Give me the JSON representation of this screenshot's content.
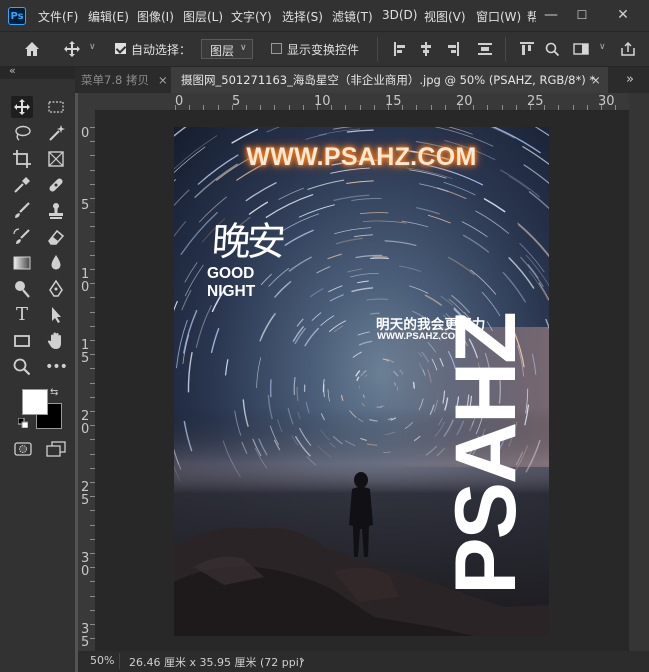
{
  "app": {
    "logo_text": "Ps",
    "menus": [
      "文件(F)",
      "编辑(E)",
      "图像(I)",
      "图层(L)",
      "文字(Y)",
      "选择(S)",
      "滤镜(T)",
      "3D(D)",
      "视图(V)",
      "窗口(W)",
      "帮"
    ],
    "window_controls": [
      "—",
      "☐",
      "✕"
    ]
  },
  "options": {
    "auto_select_label": "自动选择：",
    "auto_select_checked": true,
    "layer_mode": "图层",
    "show_transform_label": "显示变换控件",
    "show_transform_checked": false
  },
  "tabs": [
    {
      "label": "菜单7.8 拷贝",
      "close": "×",
      "active": false
    },
    {
      "label": "摄图网_501271163_海岛星空（非企业商用）.jpg @ 50% (PSAHZ, RGB/8*) *",
      "close": "×",
      "active": true
    }
  ],
  "tab_overflow": "»",
  "toolbar_collapse": "«",
  "ruler": {
    "top_labels": [
      "0",
      "5",
      "10",
      "15",
      "20",
      "25",
      "30"
    ],
    "left_labels": [
      "0",
      "5",
      "1\n0",
      "1\n5",
      "2\n0",
      "2\n5",
      "3\n0",
      "3\n5"
    ]
  },
  "image": {
    "watermark": "WWW.PSAHZ.COM",
    "title_cn": "晚安",
    "title_en_1": "GOOD",
    "title_en_2": "NIGHT",
    "slogan": "明天的我会更努力",
    "slogan_url": "WWW.PSAHZ.COM",
    "vertical_text": "PSAHZ"
  },
  "status": {
    "zoom": "50%",
    "doc_info": "26.46 厘米 x 35.95 厘米 (72 ppi)",
    "arrow": "›"
  },
  "colors": {
    "foreground": "#ffffff",
    "background": "#000000",
    "accent": "#31a8ff",
    "watermark": "#f5e7d8",
    "watermark_glow": "#ff7a1a"
  }
}
